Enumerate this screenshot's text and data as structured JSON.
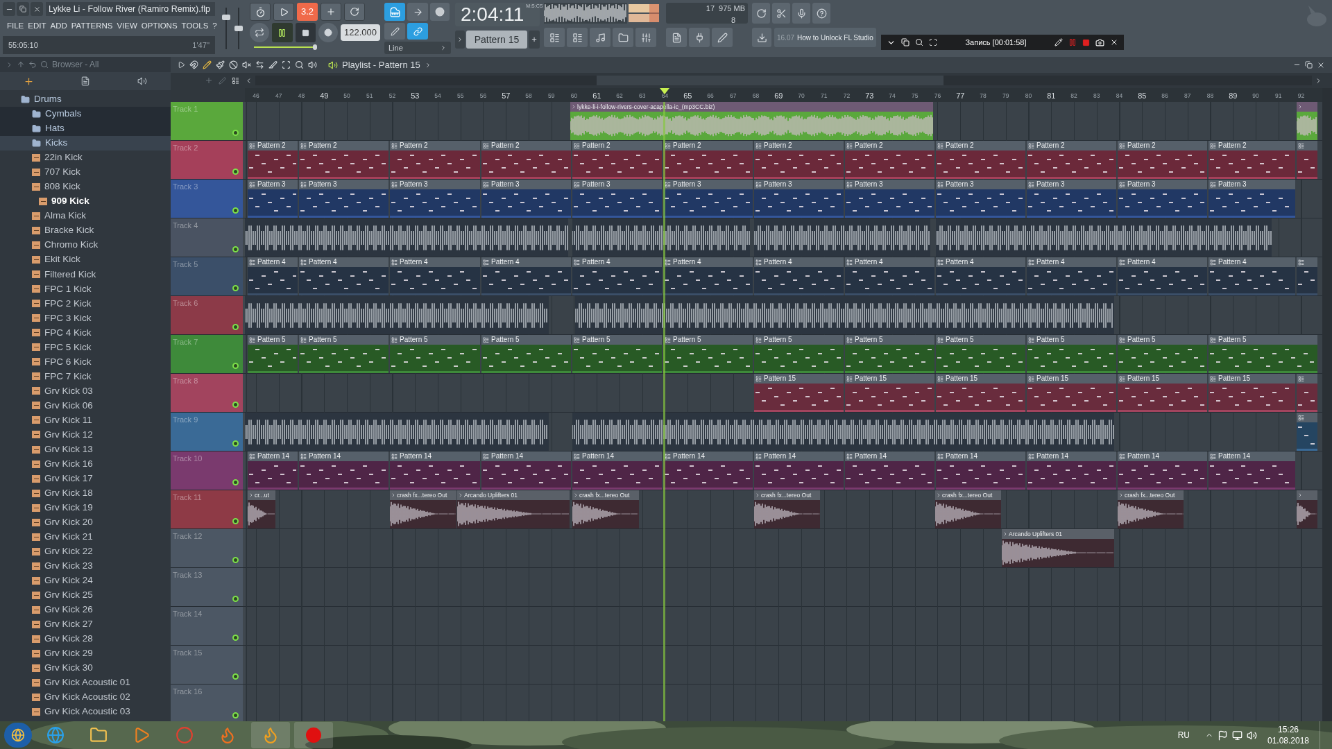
{
  "window": {
    "title": "Lykke Li - Follow River (Ramiro Remix).flp",
    "menu": [
      "FILE",
      "EDIT",
      "ADD",
      "PATTERNS",
      "VIEW",
      "OPTIONS",
      "TOOLS",
      "?"
    ],
    "song_position": "55:05:10",
    "song_length": "1'47''"
  },
  "master": {
    "volume": {
      "level": 0.8
    },
    "pitch": {
      "level": 0.5
    }
  },
  "transport": {
    "countdown": "3.2",
    "playing": true,
    "tempo": "122.000",
    "slider": {
      "level": 0.5
    },
    "keyboard_on": true,
    "link_on": true,
    "snap": "Line",
    "time": "2:04:11",
    "time_unit": "M:S:CS",
    "pattern": "Pattern 15",
    "pattern_add": "+"
  },
  "monitor": {
    "cpu": "17",
    "memory": "975 MB",
    "polyphony": "8"
  },
  "news": {
    "date": "16.07",
    "text": "How to Unlock FL Studio"
  },
  "recorder": {
    "status": "Запись [00:01:58]"
  },
  "browser": {
    "title": "Browser - All",
    "tree": [
      {
        "label": "Drums",
        "kind": "folder",
        "expanded": true,
        "selected": false,
        "children": [
          {
            "label": "Cymbals",
            "kind": "folder",
            "expanded": false,
            "selected": false
          },
          {
            "label": "Hats",
            "kind": "folder",
            "expanded": false,
            "selected": false
          },
          {
            "label": "Kicks",
            "kind": "folder",
            "expanded": true,
            "selected": false,
            "children": [
              {
                "label": "22in Kick",
                "kind": "sample",
                "selected": false
              },
              {
                "label": "707 Kick",
                "kind": "sample",
                "selected": false
              },
              {
                "label": "808 Kick",
                "kind": "sample",
                "selected": false
              },
              {
                "label": "909 Kick",
                "kind": "sample",
                "selected": true
              },
              {
                "label": "Alma Kick",
                "kind": "sample",
                "selected": false
              },
              {
                "label": "Bracke Kick",
                "kind": "sample",
                "selected": false
              },
              {
                "label": "Chromo Kick",
                "kind": "sample",
                "selected": false
              },
              {
                "label": "Ekit Kick",
                "kind": "sample",
                "selected": false
              },
              {
                "label": "Filtered Kick",
                "kind": "sample",
                "selected": false
              },
              {
                "label": "FPC 1 Kick",
                "kind": "sample",
                "selected": false
              },
              {
                "label": "FPC 2 Kick",
                "kind": "sample",
                "selected": false
              },
              {
                "label": "FPC 3 Kick",
                "kind": "sample",
                "selected": false
              },
              {
                "label": "FPC 4 Kick",
                "kind": "sample",
                "selected": false
              },
              {
                "label": "FPC 5 Kick",
                "kind": "sample",
                "selected": false
              },
              {
                "label": "FPC 6 Kick",
                "kind": "sample",
                "selected": false
              },
              {
                "label": "FPC 7 Kick",
                "kind": "sample",
                "selected": false
              },
              {
                "label": "Grv Kick 03",
                "kind": "sample",
                "selected": false
              },
              {
                "label": "Grv Kick 06",
                "kind": "sample",
                "selected": false
              },
              {
                "label": "Grv Kick 11",
                "kind": "sample",
                "selected": false
              },
              {
                "label": "Grv Kick 12",
                "kind": "sample",
                "selected": false
              },
              {
                "label": "Grv Kick 13",
                "kind": "sample",
                "selected": false
              },
              {
                "label": "Grv Kick 16",
                "kind": "sample",
                "selected": false
              },
              {
                "label": "Grv Kick 17",
                "kind": "sample",
                "selected": false
              },
              {
                "label": "Grv Kick 18",
                "kind": "sample",
                "selected": false
              },
              {
                "label": "Grv Kick 19",
                "kind": "sample",
                "selected": false
              },
              {
                "label": "Grv Kick 20",
                "kind": "sample",
                "selected": false
              },
              {
                "label": "Grv Kick 21",
                "kind": "sample",
                "selected": false
              },
              {
                "label": "Grv Kick 22",
                "kind": "sample",
                "selected": false
              },
              {
                "label": "Grv Kick 23",
                "kind": "sample",
                "selected": false
              },
              {
                "label": "Grv Kick 24",
                "kind": "sample",
                "selected": false
              },
              {
                "label": "Grv Kick 25",
                "kind": "sample",
                "selected": false
              },
              {
                "label": "Grv Kick 26",
                "kind": "sample",
                "selected": false
              },
              {
                "label": "Grv Kick 27",
                "kind": "sample",
                "selected": false
              },
              {
                "label": "Grv Kick 28",
                "kind": "sample",
                "selected": false
              },
              {
                "label": "Grv Kick 29",
                "kind": "sample",
                "selected": false
              },
              {
                "label": "Grv Kick 30",
                "kind": "sample",
                "selected": false
              },
              {
                "label": "Grv Kick Acoustic 01",
                "kind": "sample",
                "selected": false
              },
              {
                "label": "Grv Kick Acoustic 02",
                "kind": "sample",
                "selected": false
              },
              {
                "label": "Grv Kick Acoustic 03",
                "kind": "sample",
                "selected": false
              }
            ]
          }
        ]
      }
    ]
  },
  "playlist": {
    "title": "Playlist - Pattern 15",
    "ruler": [
      {
        "label": "46",
        "major": false
      },
      {
        "label": "47",
        "major": false
      },
      {
        "label": "48",
        "major": false
      },
      {
        "label": "49",
        "major": true
      },
      {
        "label": "50",
        "major": false
      },
      {
        "label": "51",
        "major": false
      },
      {
        "label": "52",
        "major": false
      },
      {
        "label": "53",
        "major": true
      },
      {
        "label": "54",
        "major": false
      },
      {
        "label": "55",
        "major": false
      },
      {
        "label": "56",
        "major": false
      },
      {
        "label": "57",
        "major": true
      },
      {
        "label": "58",
        "major": false
      },
      {
        "label": "59",
        "major": false
      },
      {
        "label": "60",
        "major": false
      },
      {
        "label": "61",
        "major": true
      },
      {
        "label": "62",
        "major": false
      },
      {
        "label": "63",
        "major": false
      },
      {
        "label": "64",
        "major": false
      },
      {
        "label": "65",
        "major": true
      },
      {
        "label": "66",
        "major": false
      },
      {
        "label": "67",
        "major": false
      },
      {
        "label": "68",
        "major": false
      },
      {
        "label": "69",
        "major": true
      },
      {
        "label": "70",
        "major": false
      },
      {
        "label": "71",
        "major": false
      },
      {
        "label": "72",
        "major": false
      },
      {
        "label": "73",
        "major": true
      },
      {
        "label": "74",
        "major": false
      },
      {
        "label": "75",
        "major": false
      },
      {
        "label": "76",
        "major": false
      },
      {
        "label": "77",
        "major": true
      },
      {
        "label": "78",
        "major": false
      },
      {
        "label": "79",
        "major": false
      },
      {
        "label": "80",
        "major": false
      },
      {
        "label": "81",
        "major": true
      },
      {
        "label": "82",
        "major": false
      },
      {
        "label": "83",
        "major": false
      },
      {
        "label": "84",
        "major": false
      },
      {
        "label": "85",
        "major": true
      },
      {
        "label": "86",
        "major": false
      },
      {
        "label": "87",
        "major": false
      },
      {
        "label": "88",
        "major": false
      },
      {
        "label": "89",
        "major": true
      },
      {
        "label": "90",
        "major": false
      },
      {
        "label": "91",
        "major": false
      },
      {
        "label": "92",
        "major": false
      }
    ],
    "tracks": [
      {
        "name": "Track 1",
        "color": "#5aa83c",
        "enabled": true,
        "clips": [
          {
            "kind": "audio",
            "label": "lykke-li-i-follow-rivers-cover-acapella-ic_(mp3CC.biz)"
          },
          {
            "kind": "audio"
          }
        ]
      },
      {
        "name": "Track 2",
        "color": "#a5405a",
        "enabled": true,
        "clips": [
          {
            "kind": "pattern",
            "label": "Pattern 2"
          },
          {
            "kind": "pattern",
            "label": "Pattern 2"
          },
          {
            "kind": "pattern",
            "label": "Pattern 2"
          },
          {
            "kind": "pattern",
            "label": "Pattern 2"
          },
          {
            "kind": "pattern",
            "label": "Pattern 2"
          },
          {
            "kind": "pattern",
            "label": "Pattern 2"
          },
          {
            "kind": "pattern",
            "label": "Pattern 2"
          },
          {
            "kind": "pattern",
            "label": "Pattern 2"
          },
          {
            "kind": "pattern",
            "label": "Pattern 2"
          },
          {
            "kind": "pattern",
            "label": "Pattern 2"
          },
          {
            "kind": "pattern",
            "label": "Pattern 2"
          },
          {
            "kind": "pattern",
            "label": "Pattern 2"
          },
          {
            "kind": "pattern"
          }
        ]
      },
      {
        "name": "Track 3",
        "color": "#34569a",
        "enabled": true,
        "clips": [
          {
            "kind": "pattern",
            "label": "Pattern 3"
          },
          {
            "kind": "pattern",
            "label": "Pattern 3"
          },
          {
            "kind": "pattern",
            "label": "Pattern 3"
          },
          {
            "kind": "pattern",
            "label": "Pattern 3"
          },
          {
            "kind": "pattern",
            "label": "Pattern 3"
          },
          {
            "kind": "pattern",
            "label": "Pattern 3"
          },
          {
            "kind": "pattern",
            "label": "Pattern 3"
          },
          {
            "kind": "pattern",
            "label": "Pattern 3"
          },
          {
            "kind": "pattern",
            "label": "Pattern 3"
          },
          {
            "kind": "pattern",
            "label": "Pattern 3"
          },
          {
            "kind": "pattern",
            "label": "Pattern 3"
          },
          {
            "kind": "pattern",
            "label": "Pattern 3"
          }
        ]
      },
      {
        "name": "Track 4",
        "color": "#4a5362",
        "enabled": true,
        "clips": [
          {
            "kind": "sample"
          },
          {
            "kind": "sample"
          },
          {
            "kind": "sample"
          },
          {
            "kind": "sample"
          }
        ]
      },
      {
        "name": "Track 5",
        "color": "#3b4f69",
        "enabled": true,
        "clips": [
          {
            "kind": "pattern",
            "label": "Pattern 4"
          },
          {
            "kind": "pattern",
            "label": "Pattern 4"
          },
          {
            "kind": "pattern",
            "label": "Pattern 4"
          },
          {
            "kind": "pattern",
            "label": "Pattern 4"
          },
          {
            "kind": "pattern",
            "label": "Pattern 4"
          },
          {
            "kind": "pattern",
            "label": "Pattern 4"
          },
          {
            "kind": "pattern",
            "label": "Pattern 4"
          },
          {
            "kind": "pattern",
            "label": "Pattern 4"
          },
          {
            "kind": "pattern",
            "label": "Pattern 4"
          },
          {
            "kind": "pattern",
            "label": "Pattern 4"
          },
          {
            "kind": "pattern",
            "label": "Pattern 4"
          },
          {
            "kind": "pattern",
            "label": "Pattern 4"
          },
          {
            "kind": "pattern"
          }
        ]
      },
      {
        "name": "Track 6",
        "color": "#8c3a48",
        "enabled": true,
        "clips": [
          {
            "kind": "sample"
          },
          {
            "kind": "sample"
          }
        ]
      },
      {
        "name": "Track 7",
        "color": "#3e8a3a",
        "enabled": true,
        "clips": [
          {
            "kind": "pattern",
            "label": "Pattern 5"
          },
          {
            "kind": "pattern",
            "label": "Pattern 5"
          },
          {
            "kind": "pattern",
            "label": "Pattern 5"
          },
          {
            "kind": "pattern",
            "label": "Pattern 5"
          },
          {
            "kind": "pattern",
            "label": "Pattern 5"
          },
          {
            "kind": "pattern",
            "label": "Pattern 5"
          },
          {
            "kind": "pattern",
            "label": "Pattern 5"
          },
          {
            "kind": "pattern",
            "label": "Pattern 5"
          },
          {
            "kind": "pattern",
            "label": "Pattern 5"
          },
          {
            "kind": "pattern",
            "label": "Pattern 5"
          },
          {
            "kind": "pattern",
            "label": "Pattern 5"
          },
          {
            "kind": "pattern",
            "label": "Pattern 5"
          }
        ]
      },
      {
        "name": "Track 8",
        "color": "#a2445e",
        "enabled": true,
        "clips": [
          {
            "kind": "pattern",
            "label": "Pattern 15"
          },
          {
            "kind": "pattern",
            "label": "Pattern 15"
          },
          {
            "kind": "pattern",
            "label": "Pattern 15"
          },
          {
            "kind": "pattern",
            "label": "Pattern 15"
          },
          {
            "kind": "pattern",
            "label": "Pattern 15"
          },
          {
            "kind": "pattern",
            "label": "Pattern 15"
          },
          {
            "kind": "pattern"
          }
        ]
      },
      {
        "name": "Track 9",
        "color": "#3a6a96",
        "enabled": true,
        "clips": [
          {
            "kind": "sample"
          },
          {
            "kind": "sample"
          },
          {
            "kind": "pattern"
          }
        ]
      },
      {
        "name": "Track 10",
        "color": "#7a3a6e",
        "enabled": true,
        "clips": [
          {
            "kind": "pattern",
            "label": "Pattern 14"
          },
          {
            "kind": "pattern",
            "label": "Pattern 14"
          },
          {
            "kind": "pattern",
            "label": "Pattern 14"
          },
          {
            "kind": "pattern",
            "label": "Pattern 14"
          },
          {
            "kind": "pattern",
            "label": "Pattern 14"
          },
          {
            "kind": "pattern",
            "label": "Pattern 14"
          },
          {
            "kind": "pattern",
            "label": "Pattern 14"
          },
          {
            "kind": "pattern",
            "label": "Pattern 14"
          },
          {
            "kind": "pattern",
            "label": "Pattern 14"
          },
          {
            "kind": "pattern",
            "label": "Pattern 14"
          },
          {
            "kind": "pattern",
            "label": "Pattern 14"
          },
          {
            "kind": "pattern",
            "label": "Pattern 14"
          }
        ]
      },
      {
        "name": "Track 11",
        "color": "#8e3a46",
        "enabled": true,
        "clips": [
          {
            "kind": "audio",
            "label": "cr...ut"
          },
          {
            "kind": "audio",
            "label": "crash fx...tereo Out"
          },
          {
            "kind": "audio",
            "label": "Arcando Uplifters 01"
          },
          {
            "kind": "audio",
            "label": "crash fx...tereo Out"
          },
          {
            "kind": "audio",
            "label": "crash fx...tereo Out"
          },
          {
            "kind": "audio",
            "label": "crash fx...tereo Out"
          },
          {
            "kind": "audio",
            "label": "crash fx...tereo Out"
          },
          {
            "kind": "audio"
          }
        ]
      },
      {
        "name": "Track 12",
        "color": "#4c5764",
        "enabled": true,
        "clips": [
          {
            "kind": "audio",
            "label": "Arcando Uplifters 01"
          }
        ]
      },
      {
        "name": "Track 13",
        "color": "#4c5764",
        "enabled": true
      },
      {
        "name": "Track 14",
        "color": "#4c5764",
        "enabled": true
      },
      {
        "name": "Track 15",
        "color": "#4c5764",
        "enabled": true
      },
      {
        "name": "Track 16",
        "color": "#4c5764",
        "enabled": true
      }
    ]
  },
  "taskbar": {
    "language": "RU",
    "time": "15:26",
    "date": "01.08.2018"
  }
}
